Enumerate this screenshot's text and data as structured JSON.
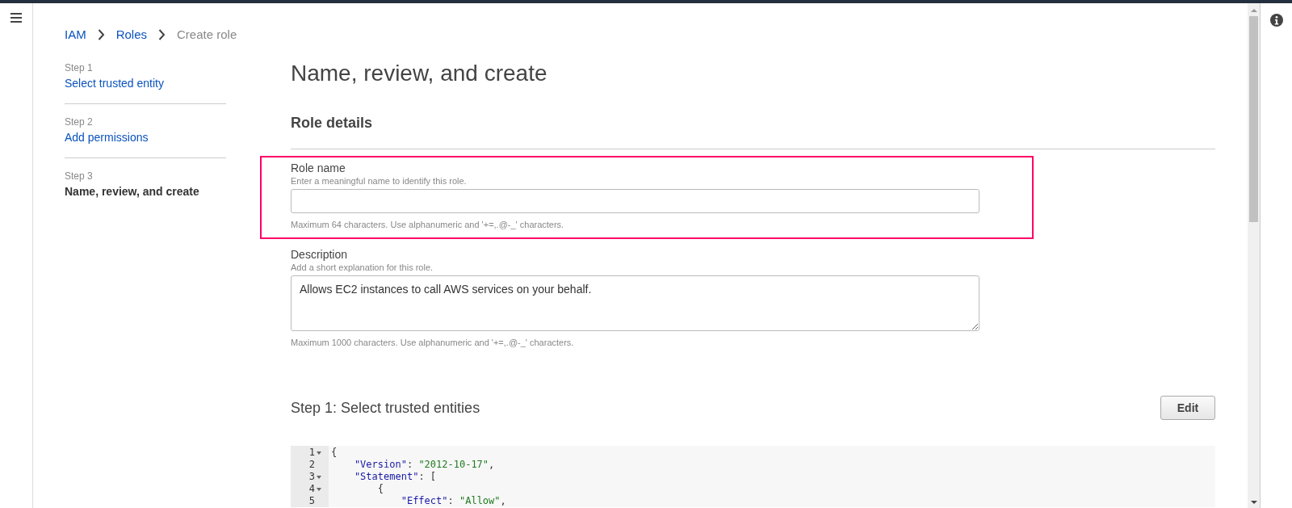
{
  "breadcrumb": [
    {
      "label": "IAM",
      "link": true
    },
    {
      "label": "Roles",
      "link": true
    },
    {
      "label": "Create role",
      "link": false
    }
  ],
  "steps": [
    {
      "step": "Step 1",
      "title": "Select trusted entity",
      "selected": false
    },
    {
      "step": "Step 2",
      "title": "Add permissions",
      "selected": false
    },
    {
      "step": "Step 3",
      "title": "Name, review, and create",
      "selected": true
    }
  ],
  "page_title": "Name, review, and create",
  "section_title": "Role details",
  "fields": [
    {
      "kind": "input",
      "label": "Role name",
      "hint": "Enter a meaningful name to identify this role.",
      "help": "Maximum 64 characters. Use alphanumeric and '+=,.@-_' characters.",
      "highlighted": true
    },
    {
      "kind": "textarea",
      "label": "Description",
      "hint": "Add a short explanation for this role.",
      "value": "Allows EC2 instances to call AWS services on your behalf.",
      "help": "Maximum 1000 characters. Use alphanumeric and '+=,.@-_' characters.",
      "highlighted": false
    }
  ],
  "step1": {
    "title": "Step 1: Select trusted entities",
    "button": "Edit"
  },
  "code": [
    {
      "number": "1",
      "fold": true,
      "tokens": [
        {
          "text": "{",
          "kind": "punct"
        }
      ]
    },
    {
      "number": "2",
      "fold": false,
      "tokens": [
        {
          "text": "    \"Version\"",
          "kind": "key"
        },
        {
          "text": ": ",
          "kind": "punct"
        },
        {
          "text": "\"2012-10-17\"",
          "kind": "string"
        },
        {
          "text": ",",
          "kind": "punct"
        }
      ]
    },
    {
      "number": "3",
      "fold": true,
      "tokens": [
        {
          "text": "    \"Statement\"",
          "kind": "key"
        },
        {
          "text": ": [",
          "kind": "punct"
        }
      ]
    },
    {
      "number": "4",
      "fold": true,
      "tokens": [
        {
          "text": "        {",
          "kind": "punct"
        }
      ]
    },
    {
      "number": "5",
      "fold": false,
      "tokens": [
        {
          "text": "            \"Effect\"",
          "kind": "key"
        },
        {
          "text": ": ",
          "kind": "punct"
        },
        {
          "text": "\"Allow\"",
          "kind": "string"
        },
        {
          "text": ",",
          "kind": "punct"
        }
      ]
    }
  ]
}
